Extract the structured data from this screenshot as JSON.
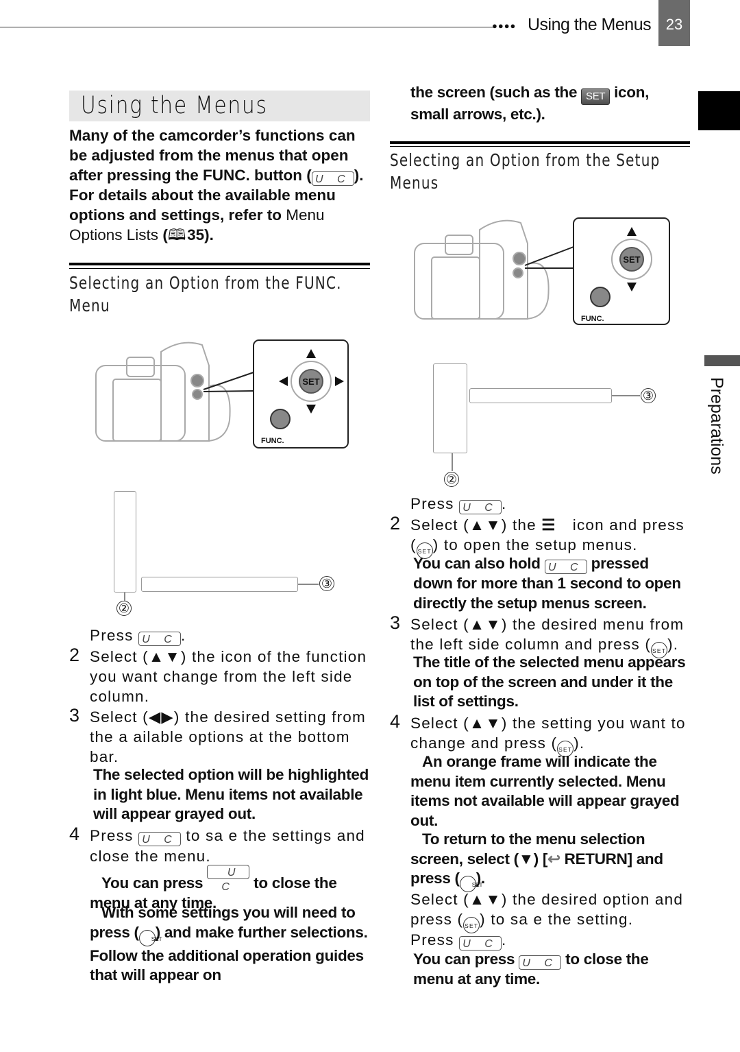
{
  "header": {
    "section_title": "Using the Menus",
    "page_number": "23",
    "dots": "●●●●"
  },
  "side_tab": {
    "label": "Preparations"
  },
  "page_title": "Using the Menus",
  "intro": {
    "line1": "Many of the camcorder’s functions can be adjusted from the menus that open after pressing the FUNC. button (",
    "line1_btn": "U C",
    "line1_end": ").",
    "line2_bold": "For details about the available menu options and settings, refer to ",
    "line2_link": "Menu Options Lists",
    "line2_ref_open": " (",
    "line2_ref_page": "35",
    "line2_end": ")."
  },
  "func_section": {
    "title": "Selecting an Option from the FUNC. Menu",
    "illustration": {
      "label_func": "FUNC.",
      "label_set": "SET"
    },
    "callouts": [
      "②",
      "③"
    ],
    "step1": {
      "text": "Press ",
      "btn": "U C",
      "end": "."
    },
    "step2": {
      "num": "2",
      "text": "Select (▲▼) the icon of the function you want change from the left side column."
    },
    "step3": {
      "num": "3",
      "text": "Select (◀▶) the desired setting from the a  ailable options at the bottom bar."
    },
    "step3_note": "The selected option will be highlighted in light blue. Menu items not available will appear grayed out.",
    "step4": {
      "num": "4",
      "pre": "Press ",
      "btn": "U C",
      "post": " to sa  e the settings and close the menu."
    },
    "step4_note1": {
      "pre": "You can press ",
      "btn": "U C",
      "post": " to close the menu at any time."
    },
    "step4_note2": {
      "pre": "With some settings you will need to press (",
      "set": "SET",
      "post": ") and make further selections. Follow the additional operation guides that will appear on"
    }
  },
  "continued_note": {
    "pre": "the screen (such as the ",
    "icon": "SET",
    "post": " icon, small arrows, etc.)."
  },
  "setup_section": {
    "title": "Selecting an Option from the Setup Menus",
    "illustration": {
      "label_func": "FUNC.",
      "label_set": "SET"
    },
    "callouts": [
      "②",
      "③"
    ],
    "step1": {
      "text": "Press ",
      "btn": "U C",
      "end": "."
    },
    "step2": {
      "num": "2",
      "pre": "Select (▲▼) the ",
      "post": " icon and press (",
      "set": "SET",
      "end": ") to open the setup menus."
    },
    "step2_note": {
      "pre": "You can also hold ",
      "btn": "U C",
      "post": " pressed down for more than 1 second to open directly the setup menus screen."
    },
    "step3": {
      "num": "3",
      "pre": "Select (▲▼) the desired menu from the left side column and press (",
      "set": "SET",
      "end": ")."
    },
    "step3_note": "The title of the selected menu appears on top of the screen and under it the list of settings.",
    "step4": {
      "num": "4",
      "pre": "Select (▲▼) the setting you want to change and press (",
      "set": "SET",
      "end": ")."
    },
    "step4_note1": "An orange frame will indicate the menu item currently selected. Menu items not available will appear grayed out.",
    "step4_note2": {
      "pre": "To return to the menu selection screen, select (▼) [",
      "icon": "↩",
      "mid": " RETURN] and press (",
      "set": "SET",
      "end": ")."
    },
    "step5": {
      "pre": "Select (▲▼) the desired option and press (",
      "set": "SET",
      "post": ") to sa  e the setting."
    },
    "step6": {
      "text": "Press ",
      "btn": "U C",
      "end": "."
    },
    "step6_note": {
      "pre": "You can press ",
      "btn": "U C",
      "post": " to close the menu at any time."
    }
  }
}
